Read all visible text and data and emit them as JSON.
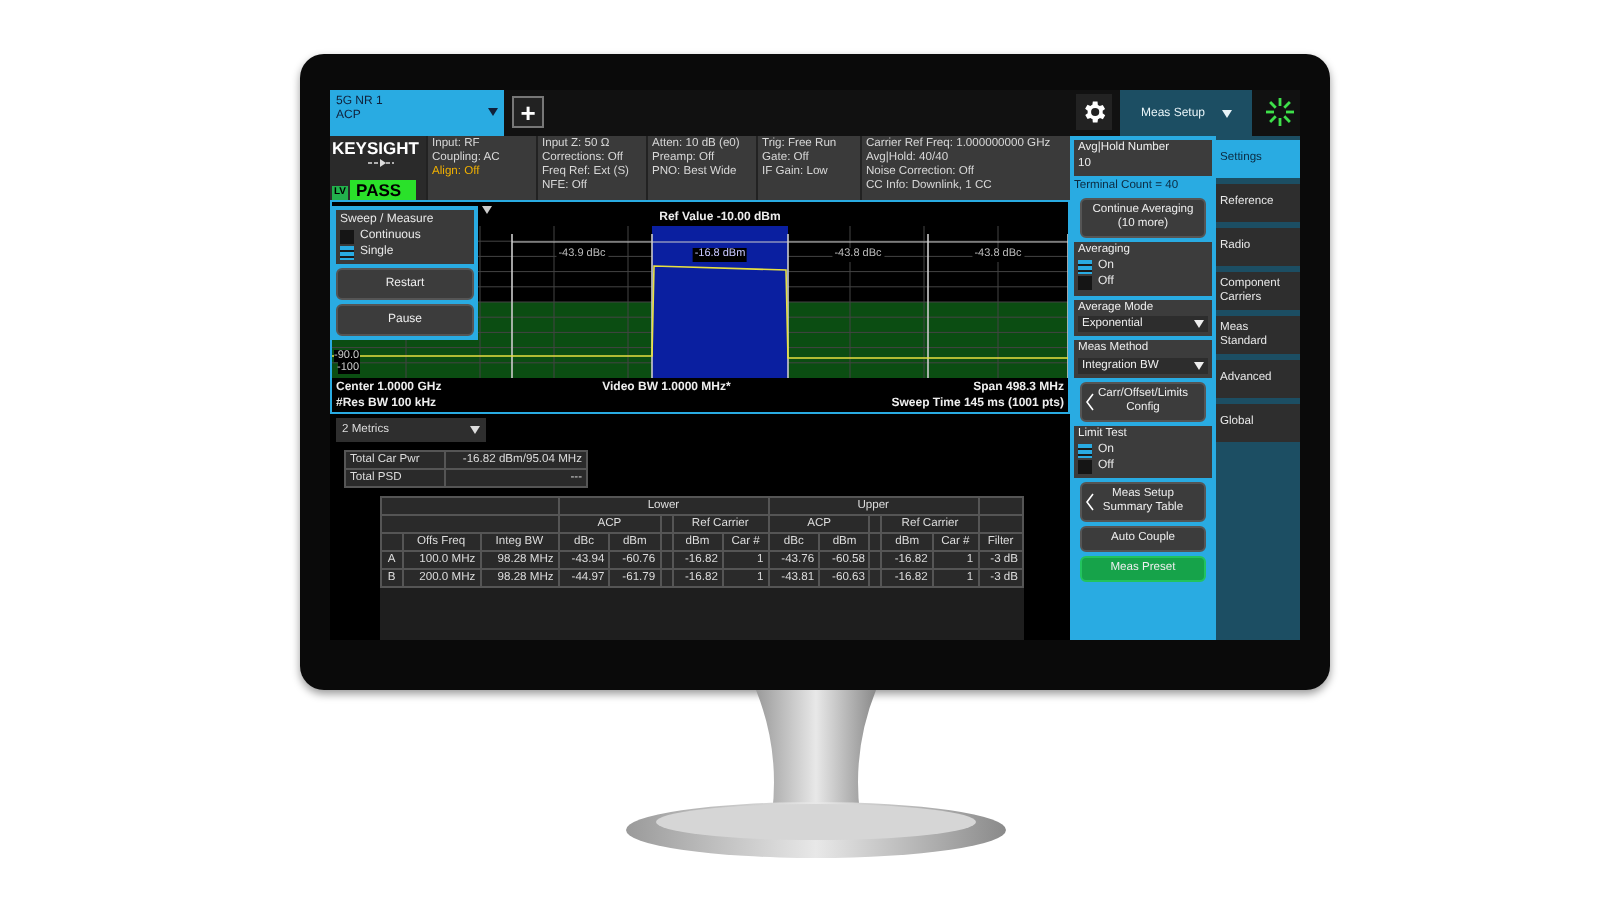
{
  "app_tab": {
    "lines": [
      "5G NR 1",
      "ACP"
    ],
    "selected": true
  },
  "add_tab": "+",
  "meas_setup_menu": "Meas Setup",
  "logo": "KEYSIGHT",
  "status": {
    "badge": "LV",
    "result": "PASS"
  },
  "info_columns": [
    [
      {
        "text": "Input: RF",
        "alert": false
      },
      {
        "text": "Coupling: AC",
        "alert": false
      },
      {
        "text": "Align: Off",
        "alert": true
      }
    ],
    [
      {
        "text": "Input Z: 50 Ω",
        "alert": false
      },
      {
        "text": "Corrections: Off",
        "alert": false
      },
      {
        "text": "Freq Ref: Ext (S)",
        "alert": false
      },
      {
        "text": "NFE: Off",
        "alert": false
      }
    ],
    [
      {
        "text": "Atten: 10 dB (e0)",
        "alert": false
      },
      {
        "text": "Preamp: Off",
        "alert": false
      },
      {
        "text": "PNO: Best Wide",
        "alert": false
      }
    ],
    [
      {
        "text": "Trig: Free Run",
        "alert": false
      },
      {
        "text": "Gate: Off",
        "alert": false
      },
      {
        "text": "IF Gain: Low",
        "alert": false
      }
    ],
    [
      {
        "text": "Carrier Ref Freq: 1.000000000 GHz",
        "alert": false
      },
      {
        "text": "Avg|Hold: 40/40",
        "alert": false
      },
      {
        "text": "Noise Correction: Off",
        "alert": false
      },
      {
        "text": "CC Info: Downlink, 1 CC",
        "alert": false
      }
    ]
  ],
  "sweep_panel": {
    "title": "Sweep / Measure",
    "options": [
      {
        "label": "Continuous",
        "selected": false
      },
      {
        "label": "Single",
        "selected": true
      }
    ],
    "buttons": [
      "Restart",
      "Pause"
    ]
  },
  "spectrum": {
    "ref_value": "Ref Value -10.00 dBm",
    "y_labels": [
      "-90.0",
      "-100"
    ],
    "segments": [
      {
        "label": "-43.9 dBc",
        "kind": "offset"
      },
      {
        "label": "-16.8 dBm",
        "kind": "carrier"
      },
      {
        "label": "-43.8 dBc",
        "kind": "offset"
      },
      {
        "label": "-43.8 dBc",
        "kind": "offset"
      }
    ],
    "footer_left": [
      "Center 1.0000 GHz",
      "#Res BW 100 kHz"
    ],
    "footer_center": "Video BW 1.0000 MHz*",
    "footer_right": [
      "Span 498.3 MHz",
      "Sweep Time 145 ms (1001 pts)"
    ]
  },
  "metrics_dropdown": "2 Metrics",
  "summary": [
    {
      "label": "Total Car Pwr",
      "value": "-16.82 dBm/95.04 MHz"
    },
    {
      "label": "Total PSD",
      "value": "---"
    }
  ],
  "acp_table": {
    "groups": [
      "Lower",
      "Upper"
    ],
    "subgroups": [
      "ACP",
      "Ref Carrier",
      "ACP",
      "Ref Carrier"
    ],
    "columns": [
      "Offs Freq",
      "Integ BW",
      "dBc",
      "dBm",
      "dBm",
      "Car #",
      "dBc",
      "dBm",
      "dBm",
      "Car #",
      "Filter"
    ],
    "rows": [
      {
        "label": "A",
        "cells": [
          "100.0 MHz",
          "98.28 MHz",
          "-43.94",
          "-60.76",
          "-16.82",
          "1",
          "-43.76",
          "-60.58",
          "-16.82",
          "1",
          "-3 dB"
        ]
      },
      {
        "label": "B",
        "cells": [
          "200.0 MHz",
          "98.28 MHz",
          "-44.97",
          "-61.79",
          "-16.82",
          "1",
          "-43.81",
          "-60.63",
          "-16.82",
          "1",
          "-3 dB"
        ]
      }
    ]
  },
  "settings": [
    {
      "kind": "field",
      "label": "Avg|Hold Number",
      "value": "10"
    },
    {
      "kind": "note",
      "text": "Terminal Count = 40"
    },
    {
      "kind": "button",
      "lines": [
        "Continue Averaging",
        "(10 more)"
      ]
    },
    {
      "kind": "toggle",
      "label": "Averaging",
      "options": [
        {
          "label": "On",
          "selected": true
        },
        {
          "label": "Off",
          "selected": false
        }
      ]
    },
    {
      "kind": "dropdown",
      "label": "Average Mode",
      "value": "Exponential"
    },
    {
      "kind": "dropdown",
      "label": "Meas Method",
      "value": "Integration BW"
    },
    {
      "kind": "submenu",
      "lines": [
        "Carr/Offset/Limits",
        "Config"
      ]
    },
    {
      "kind": "toggle",
      "label": "Limit Test",
      "options": [
        {
          "label": "On",
          "selected": true
        },
        {
          "label": "Off",
          "selected": false
        }
      ]
    },
    {
      "kind": "submenu",
      "lines": [
        "Meas Setup",
        "Summary Table"
      ]
    },
    {
      "kind": "button",
      "lines": [
        "Auto Couple"
      ]
    },
    {
      "kind": "preset",
      "lines": [
        "Meas Preset"
      ]
    }
  ],
  "menu_tabs": [
    {
      "label": "Settings",
      "selected": true
    },
    {
      "label": "Reference",
      "selected": false
    },
    {
      "label": "Radio",
      "selected": false
    },
    {
      "label": "Component Carriers",
      "selected": false
    },
    {
      "label": "Meas Standard",
      "selected": false
    },
    {
      "label": "Advanced",
      "selected": false
    },
    {
      "label": "Global",
      "selected": false
    }
  ]
}
